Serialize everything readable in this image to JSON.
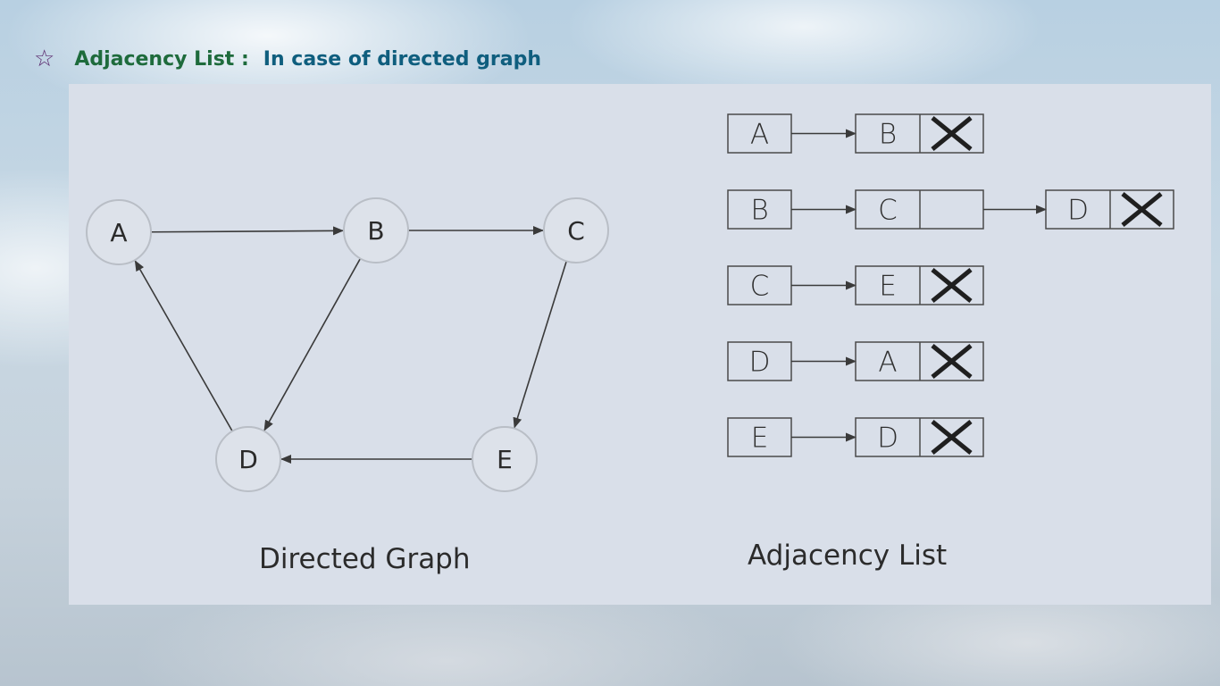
{
  "heading": {
    "star": "☆",
    "title": "Adjacency List :",
    "subtitle": "In case of directed graph"
  },
  "graph": {
    "caption": "Directed Graph",
    "nodes": [
      "A",
      "B",
      "C",
      "D",
      "E"
    ],
    "edges": [
      [
        "A",
        "B"
      ],
      [
        "B",
        "C"
      ],
      [
        "B",
        "D"
      ],
      [
        "C",
        "E"
      ],
      [
        "D",
        "A"
      ],
      [
        "E",
        "D"
      ]
    ]
  },
  "adjacency": {
    "caption": "Adjacency List",
    "null_symbol": "X",
    "rows": [
      {
        "head": "A",
        "list": [
          "B"
        ]
      },
      {
        "head": "B",
        "list": [
          "C",
          "D"
        ]
      },
      {
        "head": "C",
        "list": [
          "E"
        ]
      },
      {
        "head": "D",
        "list": [
          "A"
        ]
      },
      {
        "head": "E",
        "list": [
          "D"
        ]
      }
    ]
  },
  "colors": {
    "panel": "#d9dfe9",
    "stroke": "#3a3a3a",
    "node_fill": "#dde2ea",
    "node_stroke": "#b9bec6"
  }
}
